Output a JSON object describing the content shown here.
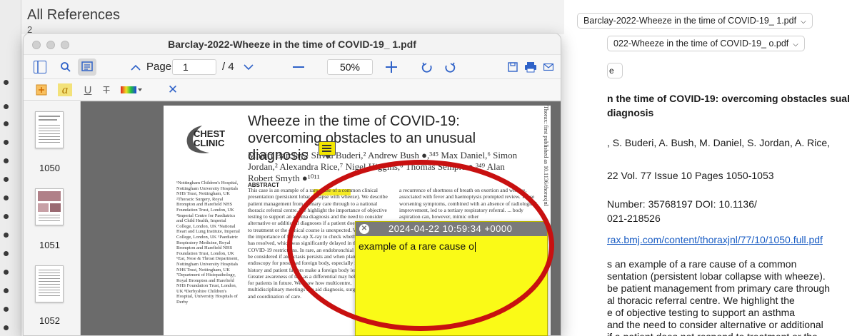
{
  "background": {
    "list_title": "All References",
    "list_subtitle": "2"
  },
  "right_panel": {
    "attachments": [
      {
        "label": "Barclay-2022-Wheeze in the time of COVID-19_ 1.pdf"
      },
      {
        "label": "022-Wheeze in the time of COVID-19_ o.pdf"
      }
    ],
    "small_button": "e",
    "title": "n the time of COVID-19: overcoming obstacles sual diagnosis",
    "authors": ", S. Buderi, A. Bush, M. Daniel, S. Jordan, A. Rice,",
    "citation": "22 Vol. 77 Issue 10 Pages 1050-1053",
    "ids_line1": "Number: 35768197 DOI: 10.1136/",
    "ids_line2": "021-218526",
    "url": "rax.bmj.com/content/thoraxjnl/77/10/1050.full.pdf",
    "abstract_lines": [
      "s an example of a rare cause of a common",
      "sentation (persistent lobar collapse with wheeze).",
      "be patient management from primary care through",
      "al thoracic referral centre. We highlight the",
      "e of objective testing to support an asthma",
      "and the need to consider alternative or additional",
      "if a patient does not respond to treatment or the"
    ]
  },
  "viewer": {
    "window_title": "Barclay-2022-Wheeze in the time of COVID-19_ 1.pdf",
    "page_label": "Page",
    "page_value": "1",
    "page_total": "/ 4",
    "zoom_value": "50%",
    "thumbnails": [
      {
        "label": "1050"
      },
      {
        "label": "1051"
      },
      {
        "label": "1052"
      }
    ],
    "colors": {
      "accent": "#2f62c8",
      "note_yellow": "#fafa17",
      "annotation_ring": "#c81010"
    }
  },
  "article": {
    "title": "Wheeze in the time of COVID-19: overcoming obstacles to an unusual diagnosis",
    "logo_line1": "CHEST",
    "logo_line2": "CLINIC",
    "authors": "Mhairi Barclay,¹ Silviu Buderi,² Andrew Bush ●,³⁴⁵ Max Daniel,⁶ Simon Jordan,² Alexandra Rice,⁷ Nigel Higgins,⁸ Thomas Semple ●,³⁴⁹ Alan Robert Smyth ●¹⁰¹¹",
    "affiliations": "¹Nottingham Children's Hospital, Nottingham University Hospitals NHS Trust, Nottingham, UK ²Thoracic Surgery, Royal Brompton and Harefield NHS Foundation Trust, London, UK ³Imperial Centre for Paediatrics and Child Health, Imperial College, London, UK ⁴National Heart and Lung Institute, Imperial College, London, UK ⁵Paediatric Respiratory Medicine, Royal Brompton and Harefield NHS Foundation Trust, London, UK ⁶Ear, Nose & Throat Department, Nottingham University Hospitals NHS Trust, Nottingham, UK ⁷Department of Histopathology, Royal Brompton and Harefield NHS Foundation Trust, London, UK ⁸Derbyshire Children's Hospital, University Hospitals of Derby",
    "abstract_heading": "ABSTRACT",
    "abstract_col1": "This case is an example of a rare cause of a common clinical presentation (persistent lobar collapse with wheeze). We describe patient management from primary care through to a national thoracic referral centre. We highlight the importance of objective testing to support an asthma diagnosis and the need to consider alternative or additional diagnoses if a patient does not respond to treatment or the clinical course is unexpected. We highlight the importance of follow-up X-ray to check whether atelectasis has resolved, which was significantly delayed in this case due to COVID-19 restrictions. In rare, an endobronchial tumour should be considered if atelectasis persists and when planning endoscopy for presumed foreign body, especially if the clinical history and patient factors make a foreign body less likely. Greater awareness of this as a differential may help diagnoses for patients in future. We show how multicentre, multidisciplinary meetings can aid diagnosis, surgical planning and coordination of care.",
    "abstract_col2": "a recurrence of shortness of breath on exertion and wheeze, associated with fever and haemoptysis prompted review. These worsening symptoms, combined with an absence of radiological improvement, led to a tertiary respiratory referral. ... body aspiration can, however, mimic other",
    "side_text": "Thorax: first published as 10.1136/thoraxjnl"
  },
  "note": {
    "date": "2024-04-22 10:59:34 +0000",
    "text": "example of a rare cause o"
  }
}
